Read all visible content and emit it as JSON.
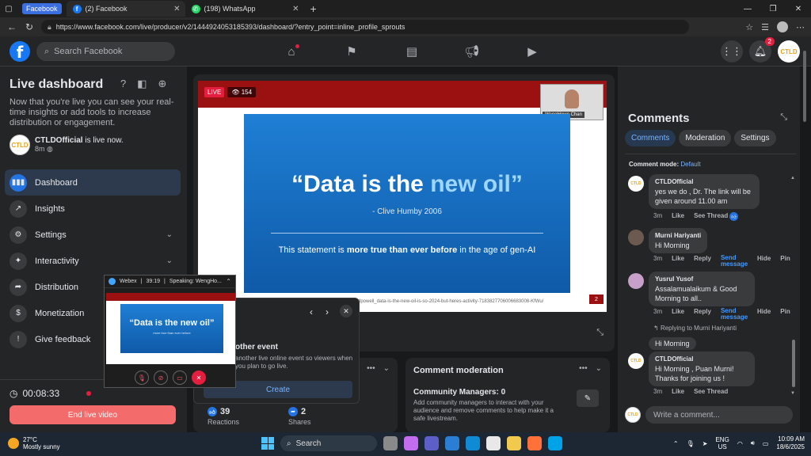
{
  "browser": {
    "tab_group": "Facebook",
    "tabs": [
      {
        "title": "(2) Facebook",
        "icon": "facebook-icon",
        "active": true
      },
      {
        "title": "(198) WhatsApp",
        "icon": "whatsapp-icon",
        "active": false
      }
    ],
    "url": "https://www.facebook.com/live/producer/v2/1444924053185393/dashboard/?entry_point=inline_profile_sprouts"
  },
  "fb_header": {
    "logo": "f",
    "search_placeholder": "Search Facebook",
    "notifications_count": "2",
    "profile_logo": "CTLD"
  },
  "sidebar": {
    "title": "Live dashboard",
    "description": "Now that you're live you can see your real-time insights or add tools to increase distribution or engagement.",
    "owner_name": "CTLDOfficial",
    "owner_status": " is live now.",
    "owner_time": "8m",
    "owner_logo": "CTLD",
    "menu": [
      {
        "label": "Dashboard",
        "icon": "dashboard-icon",
        "glyph": "▮▮▮"
      },
      {
        "label": "Insights",
        "icon": "insights-icon",
        "glyph": "↗"
      },
      {
        "label": "Settings",
        "icon": "gear-icon",
        "glyph": "⚙"
      },
      {
        "label": "Interactivity",
        "icon": "interactivity-icon",
        "glyph": "✦"
      },
      {
        "label": "Distribution",
        "icon": "share-icon",
        "glyph": "➦"
      },
      {
        "label": "Monetization",
        "icon": "dollar-icon",
        "glyph": "$"
      },
      {
        "label": "Give feedback",
        "icon": "feedback-icon",
        "glyph": "!"
      }
    ],
    "timer": "00:08:33",
    "end_button": "End live video"
  },
  "video": {
    "live_label": "LIVE",
    "viewers": "154",
    "cam_name": "WengHowe Chan",
    "quote_main": "“Data is the ",
    "quote_highlight": "new oil”",
    "author": "- Clive Humby 2006",
    "statement_pre": "This statement is ",
    "statement_bold": "more true than ever before",
    "statement_post": " in the age of gen-AI",
    "slide_url": "rdpowell_data-is-the-new-oil-is-so-2024-but-heres-activity-7183827706006683008-KfWu/",
    "slide_num": "2"
  },
  "stats": {
    "reactions_value": "39",
    "reactions_label": "Reactions",
    "shares_value": "2",
    "shares_label": "Shares"
  },
  "moderation_card": {
    "title": "Comment moderation",
    "managers": "Community Managers: 0",
    "description": "Add community managers to interact with your audience and remove comments to help make it a safe livestream."
  },
  "event_popup": {
    "title": "other event",
    "description": "another live online event so viewers when you plan to go live.",
    "create_button": "Create"
  },
  "webex": {
    "app": "Webex",
    "time": "39:19",
    "speaking": "Speaking: WengHo...",
    "mini_quote": "“Data is the new oil”"
  },
  "comments": {
    "title": "Comments",
    "tabs": [
      "Comments",
      "Moderation",
      "Settings"
    ],
    "mode_label": "Comment mode: ",
    "mode_value": "Default",
    "items": [
      {
        "name": "CTLDOfficial",
        "text": "yes we do , Dr. The link will be given around 11.00 am",
        "time": "3m",
        "actions": [
          "Like",
          "See Thread"
        ]
      },
      {
        "name": "Murni Hariyanti",
        "text": "Hi Morning",
        "time": "3m",
        "actions": [
          "Like",
          "Reply",
          "Send message",
          "Hide",
          "Pin"
        ]
      },
      {
        "name": "Yusrul Yusof",
        "text": "Assalamualaikum & Good Morning to all..",
        "time": "3m",
        "actions": [
          "Like",
          "Reply",
          "Send message",
          "Hide",
          "Pin"
        ]
      },
      {
        "name": "CTLDOfficial",
        "text": "Hi Morning , Puan Murni! Thanks for joining us !",
        "time": "3m",
        "actions": [
          "Like",
          "See Thread"
        ]
      }
    ],
    "replying_to": "Replying to Murni Hariyanti",
    "reply_quote": "Hi Morning",
    "input_placeholder": "Write a comment..."
  },
  "taskbar": {
    "temperature": "27°C",
    "weather": "Mostly sunny",
    "search": "Search",
    "lang1": "ENG",
    "lang2": "US",
    "time": "10:09 AM",
    "date": "18/6/2025"
  }
}
